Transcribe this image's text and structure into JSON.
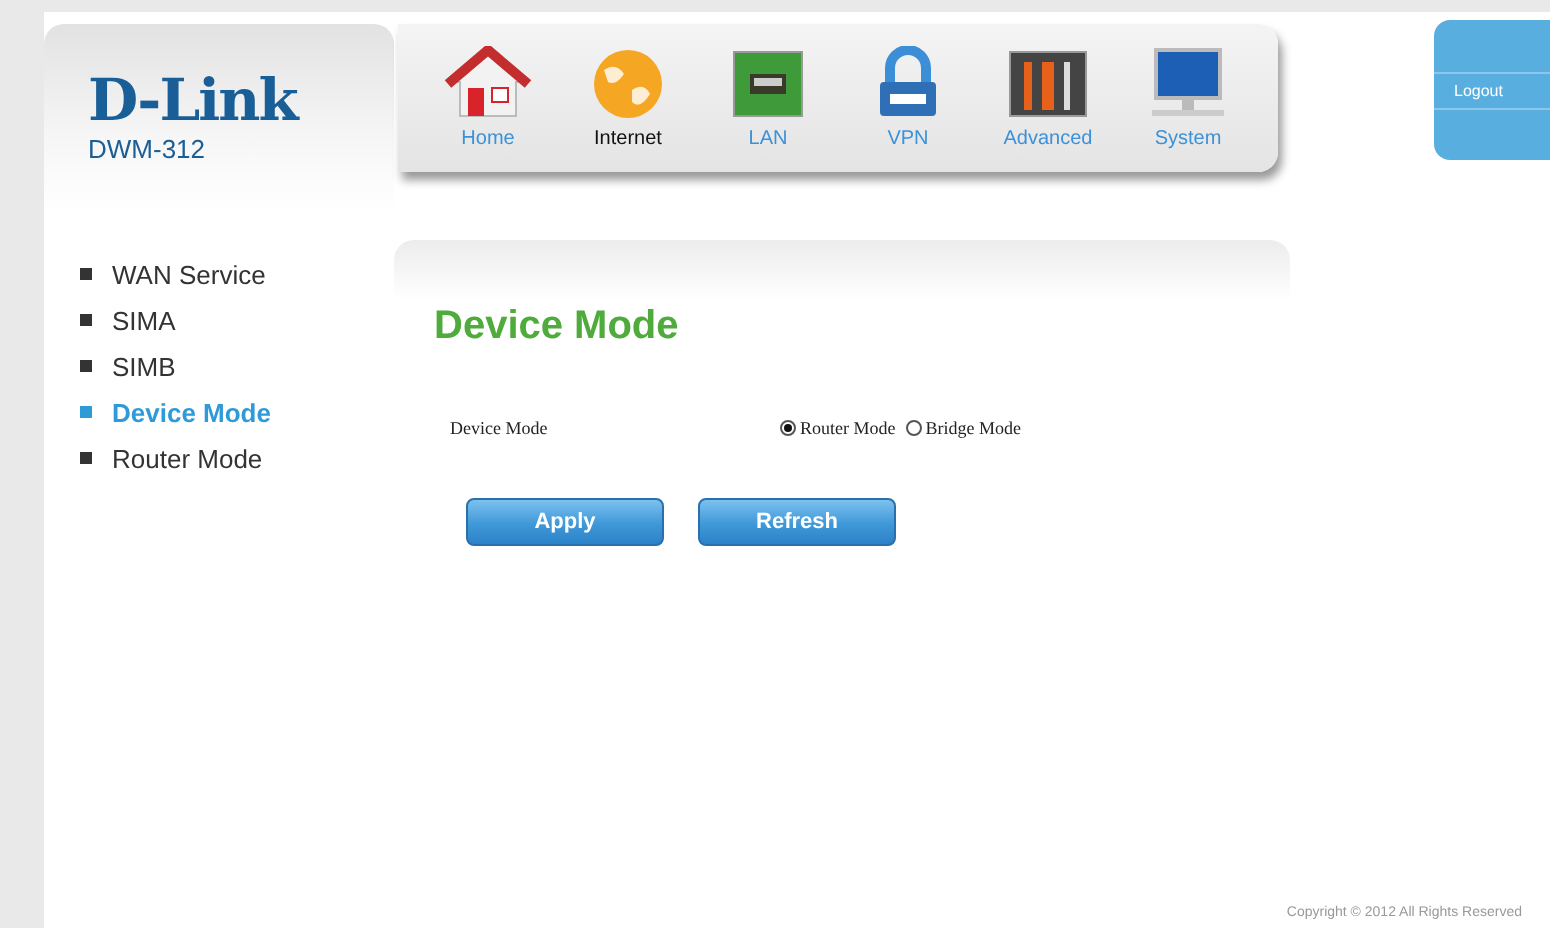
{
  "logo": {
    "brand": "D-Link",
    "model": "DWM-312"
  },
  "nav": [
    {
      "label": "Home",
      "selected": false
    },
    {
      "label": "Internet",
      "selected": true
    },
    {
      "label": "LAN",
      "selected": false
    },
    {
      "label": "VPN",
      "selected": false
    },
    {
      "label": "Advanced",
      "selected": false
    },
    {
      "label": "System",
      "selected": false
    }
  ],
  "logout": "Logout",
  "sidebar": {
    "items": [
      {
        "label": "WAN Service",
        "selected": false
      },
      {
        "label": "SIMA",
        "selected": false
      },
      {
        "label": "SIMB",
        "selected": false
      },
      {
        "label": "Device Mode",
        "selected": true
      },
      {
        "label": "Router Mode",
        "selected": false
      }
    ]
  },
  "content": {
    "title": "Device Mode",
    "field": {
      "label": "Device Mode",
      "options": [
        {
          "label": "Router Mode",
          "selected": true
        },
        {
          "label": "Bridge Mode",
          "selected": false
        }
      ]
    },
    "buttons": [
      "Apply",
      "Refresh"
    ]
  },
  "footer": "Copyright © 2012  All Rights Reserved"
}
